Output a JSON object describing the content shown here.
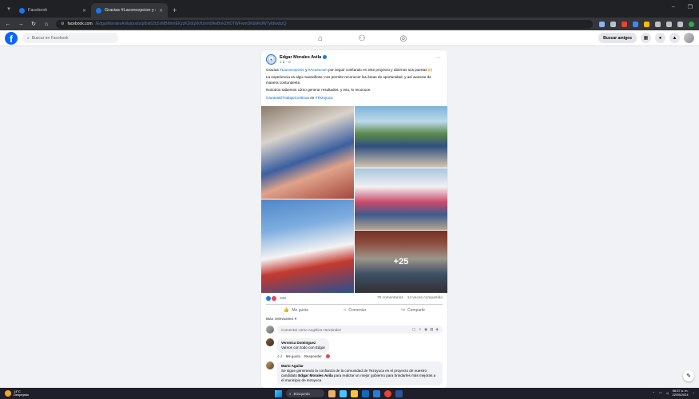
{
  "browser": {
    "tabs": [
      {
        "title": "Facebook",
        "active": false
      },
      {
        "title": "Gracias #Laconcepcion y #Acu...",
        "active": true
      }
    ],
    "new_tab": "+",
    "url_host": "facebook.com",
    "url_path": "/EdgarMoralesAvila/posts/pfbid02b5xMBMrmEKzzKDdqXkHznm0fkeBnkZHDTWFwmDKbMn9WTyfdkwbzQ",
    "window_controls": [
      "–",
      "❐"
    ]
  },
  "fb_header": {
    "logo": "f",
    "search_placeholder": "Buscar en Facebook",
    "find_friends": "Buscar amigos"
  },
  "post": {
    "author": "Edgar Morales Avila",
    "meta": "1 d · ⊙",
    "more": "···",
    "text_line1_prefix": "Gracias ",
    "tag1": "#Laconcepcion",
    "text_line1_mid": " y ",
    "tag2": "#Acuexcom",
    "text_line1_suffix": " por seguir confiando en este proyecto y abrirnos sus puertas 🙌",
    "text_p2": "La experiencia es algo maravilloso; nos permite reconocer las áreas de oportunidad, y así avanzar de manera contundente.",
    "text_p3": "Nosotros sabemos cómo generar resultados, y eso, lo reconoce:",
    "hashtags": "#JuntosElTrabajoContinua",
    "hashtags_mid": " en ",
    "hashtag_place": "#Tezoyuca",
    "more_photos": "+25",
    "reaction_count": "335",
    "comments_count": "76 comentarios",
    "shares_count": "14 veces compartido",
    "like_label": "Me gusta",
    "comment_label": "Comentar",
    "share_label": "Compartir",
    "sort_label": "Más relevantes ▾",
    "comment_placeholder": "Comentar como Angélica Hernández",
    "comments": [
      {
        "name": "Veronica Dominguez",
        "text": "Vamos con todo con Edgar",
        "time": "4 d",
        "like": "Me gusta",
        "reply": "Responder"
      },
      {
        "name": "Mario Aguilar",
        "text_before": "Se sigue generando la confianza de la comunidad de Tezoyuca en el proyecto de nuestro candidato ",
        "text_bold": "Edgar Morales Avila",
        "text_after": " para realizar un mejor gobierno para brindarles más mejoras a el municipio de tezoyuca"
      }
    ]
  },
  "taskbar": {
    "weather_temp": "14°C",
    "weather_desc": "Despejado",
    "search_label": "Búsqueda",
    "time": "08:37 a. m.",
    "date": "22/05/2024"
  },
  "colors": {
    "fb_blue": "#0866ff",
    "link": "#0064d1",
    "like_blue": "#1877f2",
    "love_red": "#f33e58"
  }
}
